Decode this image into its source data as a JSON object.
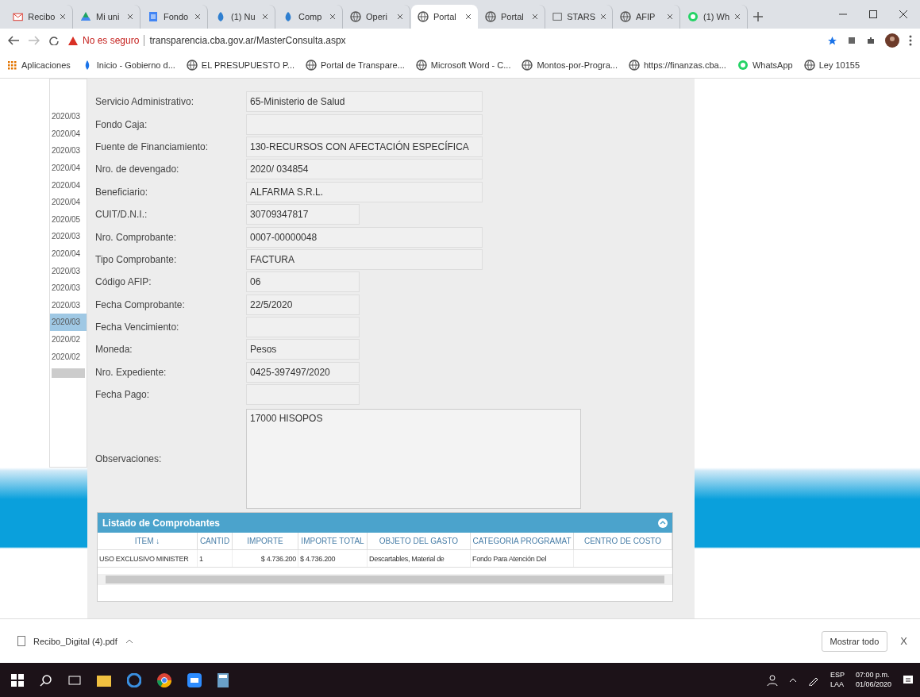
{
  "tabs": [
    {
      "label": "Recibo",
      "kind": "mail",
      "selected": false
    },
    {
      "label": "Mi uni",
      "kind": "drive",
      "selected": false
    },
    {
      "label": "Fondo",
      "kind": "docs",
      "selected": false
    },
    {
      "label": "(1) Nu",
      "kind": "leaf",
      "selected": false
    },
    {
      "label": "Comp",
      "kind": "leaf",
      "selected": false
    },
    {
      "label": "Operi",
      "kind": "globe",
      "selected": false
    },
    {
      "label": "Portal",
      "kind": "globe",
      "selected": true
    },
    {
      "label": "Portal",
      "kind": "globe",
      "selected": false
    },
    {
      "label": "STARS",
      "kind": "text",
      "selected": false
    },
    {
      "label": "AFIP",
      "kind": "globe",
      "selected": false
    },
    {
      "label": "(1) Wh",
      "kind": "whatsapp",
      "selected": false
    }
  ],
  "address": {
    "warning": "No es seguro",
    "url": "transparencia.cba.gov.ar/MasterConsulta.aspx"
  },
  "bookmarks": [
    {
      "label": "Aplicaciones",
      "kind": "apps"
    },
    {
      "label": "Inicio - Gobierno d...",
      "kind": "drop"
    },
    {
      "label": "EL PRESUPUESTO P...",
      "kind": "globe"
    },
    {
      "label": "Portal de Transpare...",
      "kind": "globe"
    },
    {
      "label": "Microsoft Word - C...",
      "kind": "globe"
    },
    {
      "label": "Montos-por-Progra...",
      "kind": "globe"
    },
    {
      "label": "https://finanzas.cba...",
      "kind": "globe"
    },
    {
      "label": "WhatsApp",
      "kind": "whatsapp"
    },
    {
      "label": "Ley 10155",
      "kind": "globe"
    }
  ],
  "side_list": {
    "items": [
      {
        "label": "2020/03",
        "selected": false
      },
      {
        "label": "2020/04",
        "selected": false
      },
      {
        "label": "2020/03",
        "selected": false
      },
      {
        "label": "2020/04",
        "selected": false
      },
      {
        "label": "2020/04",
        "selected": false
      },
      {
        "label": "2020/04",
        "selected": false
      },
      {
        "label": "2020/05",
        "selected": false
      },
      {
        "label": "2020/03",
        "selected": false
      },
      {
        "label": "2020/04",
        "selected": false
      },
      {
        "label": "2020/03",
        "selected": false
      },
      {
        "label": "2020/03",
        "selected": false
      },
      {
        "label": "2020/03",
        "selected": false
      },
      {
        "label": "2020/03",
        "selected": true
      },
      {
        "label": "2020/02",
        "selected": false
      },
      {
        "label": "2020/02",
        "selected": false
      }
    ]
  },
  "form": {
    "fields": [
      {
        "label": "Servicio Administrativo:",
        "value": "65-Ministerio de Salud",
        "kind": "wide"
      },
      {
        "label": "Fondo Caja:",
        "kind": "wide"
      },
      {
        "label": "Fuente de Financiamiento:",
        "value": "130-RECURSOS CON AFECTACIÓN ESPECÍFICA",
        "kind": "wide"
      },
      {
        "label": "Nro. de devengado:",
        "value": "2020/ 034854",
        "kind": "wide"
      },
      {
        "label": "Beneficiario:",
        "value": "ALFARMA S.R.L.",
        "kind": "wide"
      },
      {
        "label": "CUIT/D.N.I.:",
        "value": "30709347817",
        "kind": "narrow"
      },
      {
        "label": "Nro. Comprobante:",
        "value": "0007-00000048",
        "kind": "wide"
      },
      {
        "label": "Tipo Comprobante:",
        "value": "FACTURA",
        "kind": "wide"
      },
      {
        "label": "Código AFIP:",
        "value": "06",
        "kind": "narrow"
      },
      {
        "label": "Fecha Comprobante:",
        "value": "22/5/2020",
        "kind": "narrow"
      },
      {
        "label": "Fecha Vencimiento:",
        "kind": "narrow"
      },
      {
        "label": "Moneda:",
        "value": "Pesos",
        "kind": "narrow"
      },
      {
        "label": "Nro. Expediente:",
        "value": "0425-397497/2020",
        "kind": "narrow"
      },
      {
        "label": "Fecha Pago:",
        "kind": "narrow"
      }
    ],
    "observaciones": {
      "label": "Observaciones:",
      "value": "17000 HISOPOS"
    }
  },
  "grid": {
    "title": "Listado de Comprobantes",
    "columns": [
      "ITEM ↓",
      "CANTID",
      "IMPORTE",
      "IMPORTE TOTAL",
      "OBJETO DEL GASTO",
      "CATEGORIA PROGRAMAT",
      "CENTRO DE COSTO"
    ],
    "rows": [
      [
        "USO EXCLUSIVO MINISTER",
        "1",
        "$ 4.736.200",
        "$ 4.736.200",
        "Descartables, Material de",
        "Fondo Para Atención Del",
        ""
      ]
    ]
  },
  "download_bar": {
    "file": "Recibo_Digital (4).pdf",
    "show_all": "Mostrar todo",
    "close": "X"
  },
  "taskbar": {
    "lang": "ESP",
    "layout": "LAA",
    "time": "07:00 p.m.",
    "date": "01/06/2020"
  }
}
